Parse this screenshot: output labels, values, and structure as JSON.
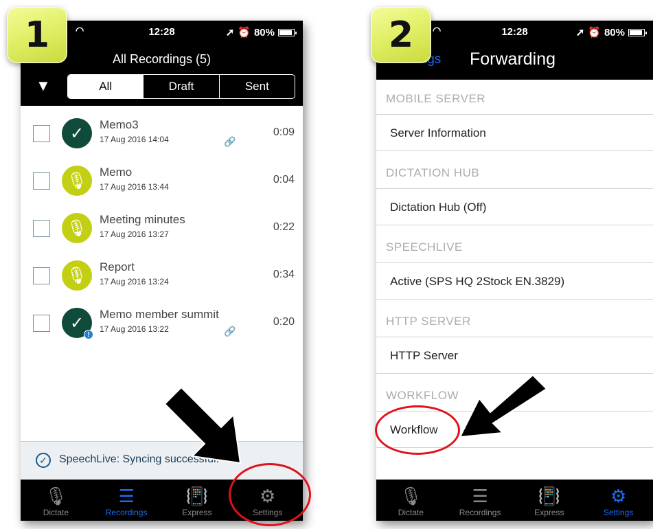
{
  "badges": {
    "first": "1",
    "second": "2"
  },
  "status": {
    "time": "12:28",
    "battery": "80%"
  },
  "screen1": {
    "title": "All Recordings (5)",
    "segments": [
      "All",
      "Draft",
      "Sent"
    ],
    "recordings": [
      {
        "name": "Memo3",
        "date": "17 Aug 2016 14:04",
        "duration": "0:09",
        "status": "sent",
        "linked": true,
        "warning": false
      },
      {
        "name": "Memo",
        "date": "17 Aug 2016 13:44",
        "duration": "0:04",
        "status": "draft",
        "linked": false,
        "warning": false
      },
      {
        "name": "Meeting minutes",
        "date": "17 Aug 2016 13:27",
        "duration": "0:22",
        "status": "draft",
        "linked": false,
        "warning": false
      },
      {
        "name": "Report",
        "date": "17 Aug 2016 13:24",
        "duration": "0:34",
        "status": "draft",
        "linked": false,
        "warning": false
      },
      {
        "name": "Memo member summit",
        "date": "17 Aug 2016 13:22",
        "duration": "0:20",
        "status": "sent",
        "linked": true,
        "warning": true
      }
    ],
    "sync_text": "SpeechLive: Syncing successful.",
    "tabs": [
      "Dictate",
      "Recordings",
      "Express",
      "Settings"
    ],
    "active_tab": "Recordings"
  },
  "screen2": {
    "back_label": "Settings",
    "title": "Forwarding",
    "sections": [
      {
        "header": "MOBILE SERVER",
        "item": "Server Information"
      },
      {
        "header": "DICTATION HUB",
        "item": "Dictation Hub (Off)"
      },
      {
        "header": "SPEECHLIVE",
        "item": "Active (SPS HQ 2Stock EN.3829)"
      },
      {
        "header": "HTTP SERVER",
        "item": "HTTP Server"
      },
      {
        "header": "WORKFLOW",
        "item": "Workflow"
      }
    ],
    "tabs": [
      "Dictate",
      "Recordings",
      "Express",
      "Settings"
    ],
    "active_tab": "Settings"
  },
  "colors": {
    "accent": "#1d6cf0",
    "sent": "#0f4a3a",
    "draft": "#c3cf13",
    "highlight": "#e0111b"
  },
  "icons": {
    "filter": "funnel-icon",
    "mic": "microphone-icon",
    "list": "list-icon",
    "express": "vibrate-phone-icon",
    "settings": "gear-icon",
    "check": "checkmark-icon",
    "link": "link-icon"
  }
}
